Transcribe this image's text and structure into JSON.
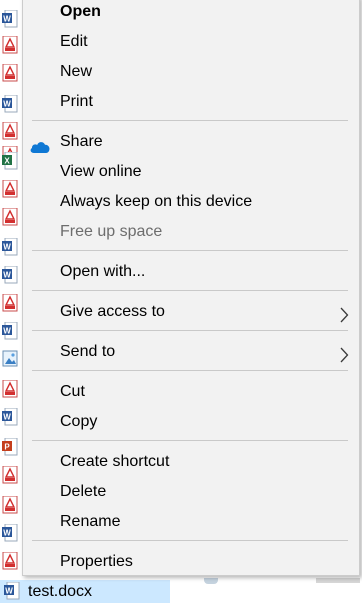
{
  "menu": {
    "items": {
      "open": "Open",
      "edit": "Edit",
      "new": "New",
      "print": "Print",
      "share": "Share",
      "view_online": "View online",
      "always_keep": "Always keep on this device",
      "free_up_space": "Free up space",
      "open_with": "Open with...",
      "give_access_to": "Give access to",
      "send_to": "Send to",
      "cut": "Cut",
      "copy": "Copy",
      "create_shortcut": "Create shortcut",
      "delete": "Delete",
      "rename": "Rename",
      "properties": "Properties"
    }
  },
  "explorer": {
    "selected_file": "test.docx",
    "file_icons": [
      "word-icon",
      "pdf-icon",
      "pdf-icon",
      "word-icon",
      "pdf-icon",
      "pdf-icon",
      "excel-icon",
      "pdf-icon",
      "pdf-icon",
      "word-icon",
      "word-icon",
      "pdf-icon",
      "pdf-icon",
      "word-icon",
      "image-icon",
      "pdf-icon",
      "word-icon",
      "powerpoint-icon",
      "pdf-icon",
      "pdf-icon",
      "word-icon",
      "pdf-icon"
    ]
  },
  "colors": {
    "menu_background": "#f2f2f2",
    "selection_background": "#cce8ff",
    "disabled_text": "#6d6d6d",
    "onedrive_blue": "#0f78d4"
  }
}
